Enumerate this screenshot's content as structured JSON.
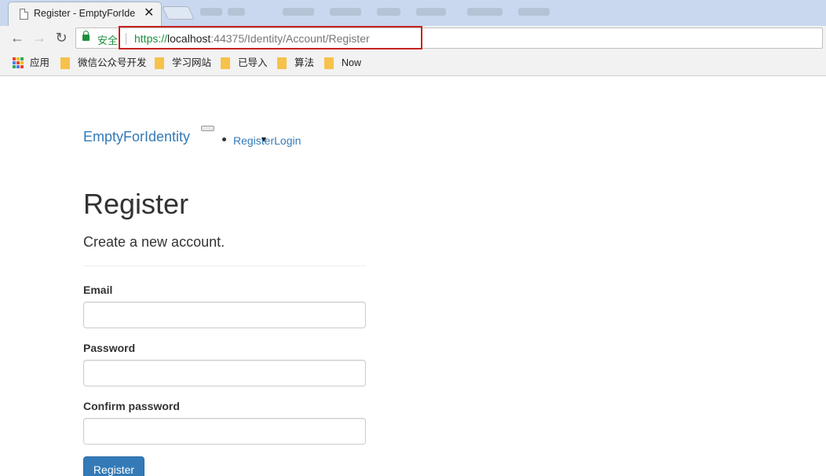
{
  "browser": {
    "tab": {
      "title": "Register - EmptyForIde",
      "close": "✕"
    },
    "omnibox": {
      "secure_label": "安全",
      "url_scheme": "https://",
      "url_host": "localhost",
      "url_rest": ":44375/Identity/Account/Register"
    },
    "bookmarks": [
      {
        "label": "应用",
        "icon": "apps-icon"
      },
      {
        "label": "微信公众号开发",
        "icon": "folder-icon"
      },
      {
        "label": "学习网站",
        "icon": "folder-icon"
      },
      {
        "label": "已导入",
        "icon": "folder-icon"
      },
      {
        "label": "算法",
        "icon": "folder-icon"
      },
      {
        "label": "Now",
        "icon": "folder-icon"
      }
    ]
  },
  "page": {
    "brand": "EmptyForIdentity",
    "nav": {
      "register": "Register",
      "login": "Login"
    },
    "title": "Register",
    "subtitle": "Create a new account.",
    "form": {
      "email_label": "Email",
      "password_label": "Password",
      "confirm_label": "Confirm password",
      "submit_label": "Register"
    }
  }
}
